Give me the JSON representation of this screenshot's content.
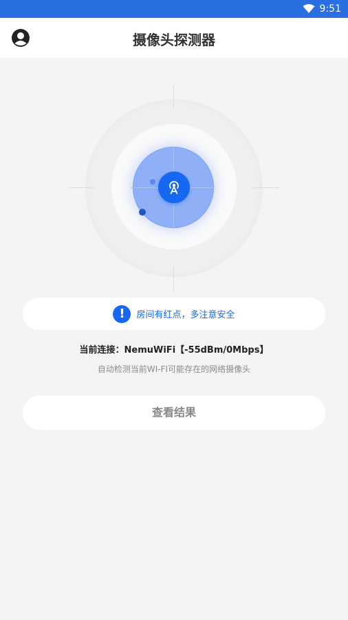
{
  "status_bar": {
    "time": "9:51",
    "bg_color": "#2a6fe2"
  },
  "app_bar": {
    "title": "摄像头探测器",
    "account_icon": "account-circle-icon"
  },
  "radar": {
    "center_icon": "signal-tower-icon",
    "accent": "#1668f0"
  },
  "alert": {
    "icon": "exclamation-icon",
    "text": "房间有红点，多注意安全"
  },
  "connection": {
    "text": "当前连接：NemuWiFi【-55dBm/0Mbps】",
    "description": "自动检测当前WI-FI可能存在的网络摄像头"
  },
  "actions": {
    "view_results_label": "查看结果"
  }
}
